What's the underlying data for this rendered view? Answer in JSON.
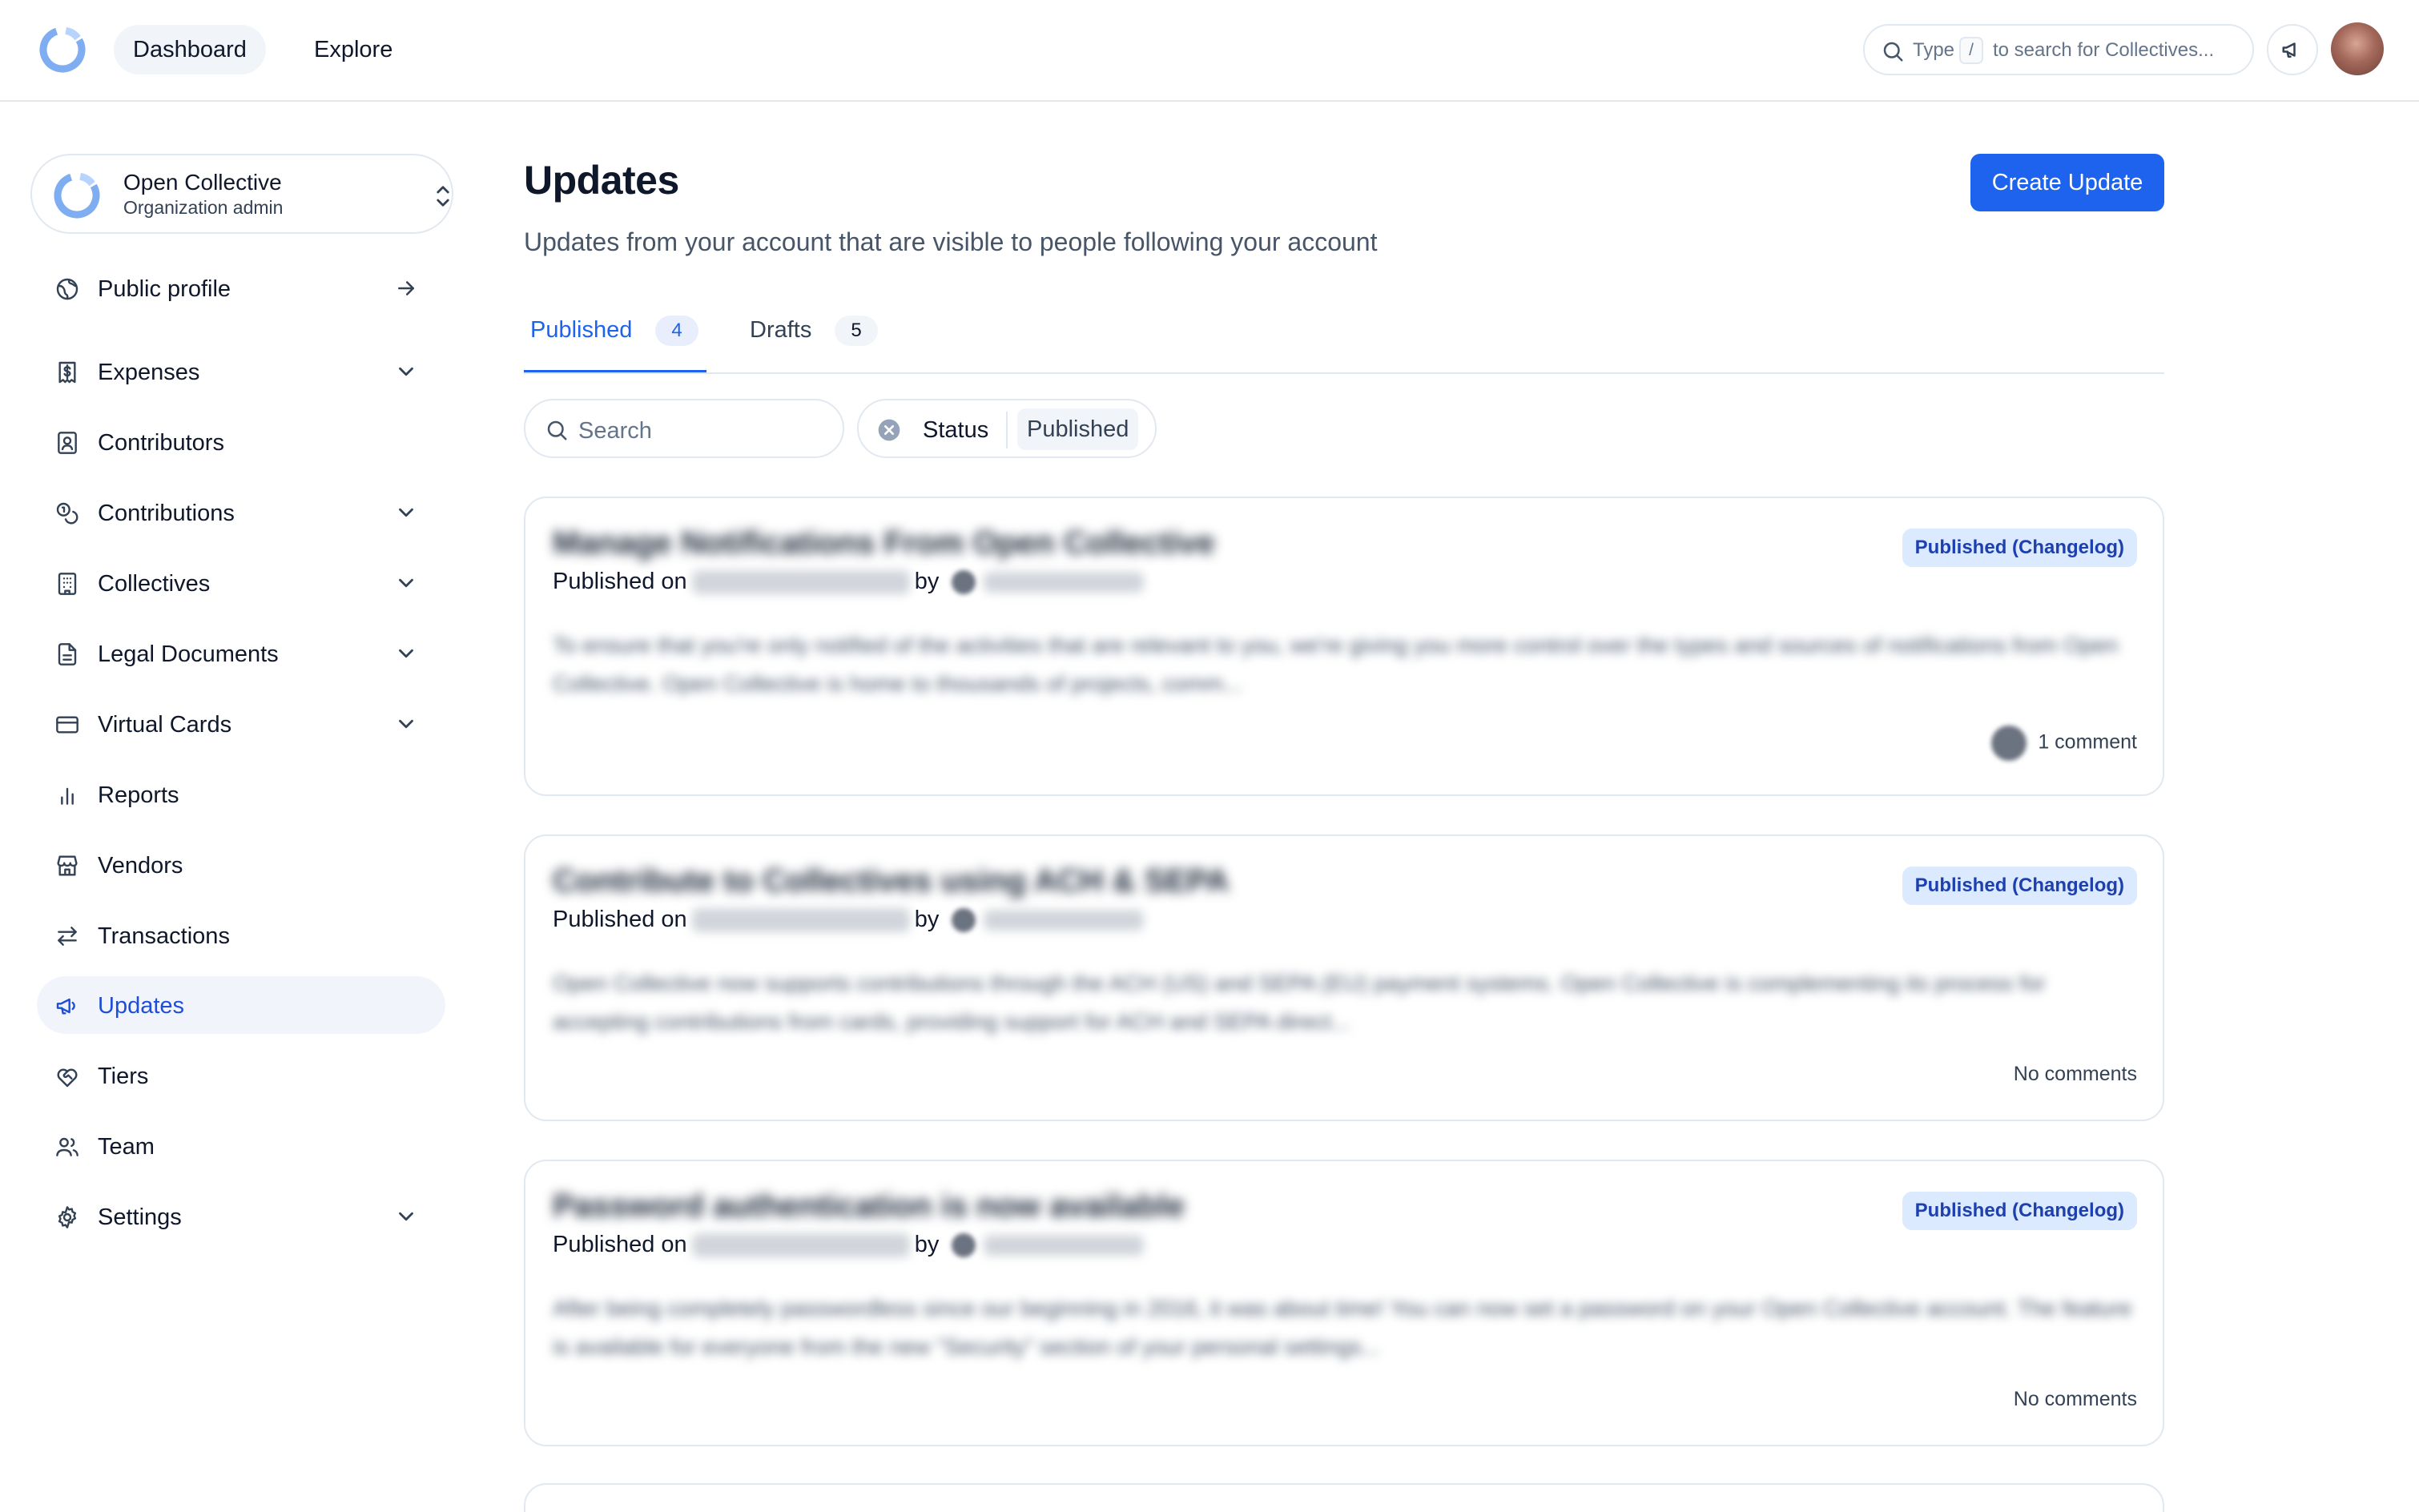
{
  "topbar": {
    "nav": [
      {
        "label": "Dashboard",
        "active": true
      },
      {
        "label": "Explore",
        "active": false
      }
    ],
    "search": {
      "prefix": "Type",
      "key": "/",
      "suffix": "to search for Collectives..."
    },
    "icons": {
      "logo": "opencollective-logo",
      "search": "search-icon",
      "announce": "megaphone-icon",
      "avatar": "user-avatar"
    }
  },
  "account": {
    "name": "Open Collective",
    "role": "Organization admin",
    "switch_icon": "chevron-up-down-icon"
  },
  "sidebar": {
    "items": [
      {
        "label": "Public profile",
        "icon": "globe-icon",
        "right_icon": "arrow-right-icon",
        "active": false
      },
      {
        "label": "Expenses",
        "icon": "receipt-dollar-icon",
        "right_icon": "chevron-down-icon",
        "active": false
      },
      {
        "label": "Contributors",
        "icon": "contact-card-icon",
        "right_icon": "",
        "active": false
      },
      {
        "label": "Contributions",
        "icon": "coins-icon",
        "right_icon": "chevron-down-icon",
        "active": false
      },
      {
        "label": "Collectives",
        "icon": "building-icon",
        "right_icon": "chevron-down-icon",
        "active": false
      },
      {
        "label": "Legal Documents",
        "icon": "document-icon",
        "right_icon": "chevron-down-icon",
        "active": false
      },
      {
        "label": "Virtual Cards",
        "icon": "credit-card-icon",
        "right_icon": "chevron-down-icon",
        "active": false
      },
      {
        "label": "Reports",
        "icon": "bar-chart-icon",
        "right_icon": "",
        "active": false
      },
      {
        "label": "Vendors",
        "icon": "store-icon",
        "right_icon": "",
        "active": false
      },
      {
        "label": "Transactions",
        "icon": "arrows-left-right-icon",
        "right_icon": "",
        "active": false
      },
      {
        "label": "Updates",
        "icon": "megaphone-icon",
        "right_icon": "",
        "active": true
      },
      {
        "label": "Tiers",
        "icon": "heart-handshake-icon",
        "right_icon": "",
        "active": false
      },
      {
        "label": "Team",
        "icon": "users-icon",
        "right_icon": "",
        "active": false
      },
      {
        "label": "Settings",
        "icon": "gear-icon",
        "right_icon": "chevron-down-icon",
        "active": false
      }
    ]
  },
  "main": {
    "title": "Updates",
    "subtitle": "Updates from your account that are visible to people following your account",
    "create_button": "Create Update",
    "tabs": [
      {
        "label": "Published",
        "count": "4",
        "active": true
      },
      {
        "label": "Drafts",
        "count": "5",
        "active": false
      }
    ],
    "search_placeholder": "Search",
    "filter": {
      "label": "Status",
      "value": "Published",
      "clear_icon": "x-circle-icon"
    },
    "accent": "#1d63ed"
  },
  "updates": [
    {
      "title": "Manage Notifications From Open Collective",
      "status": "Published (Changelog)",
      "published_prefix": "Published on",
      "by": "by",
      "excerpt": "To ensure that you're only notified of the activities that are relevant to you, we're giving you more control over the types and sources of notifications from Open Collective. Open Collective is home to thousands of projects, comm...",
      "comments": "1 comment"
    },
    {
      "title": "Contribute to Collectives using ACH & SEPA",
      "status": "Published (Changelog)",
      "published_prefix": "Published on",
      "by": "by",
      "excerpt": "Open Collective now supports contributions through the ACH (US) and SEPA (EU) payment systems. Open Collective is complementing its process for accepting contributions from cards, providing support for ACH and SEPA direct...",
      "comments": "No comments"
    },
    {
      "title": "Password authentication is now available",
      "status": "Published (Changelog)",
      "published_prefix": "Published on",
      "by": "by",
      "excerpt": "After being completely passwordless since our beginning in 2016, it was about time! You can now set a password on your Open Collective account. The feature is available for everyone from the new \"Security\" section of your personal settings...",
      "comments": "No comments"
    }
  ]
}
